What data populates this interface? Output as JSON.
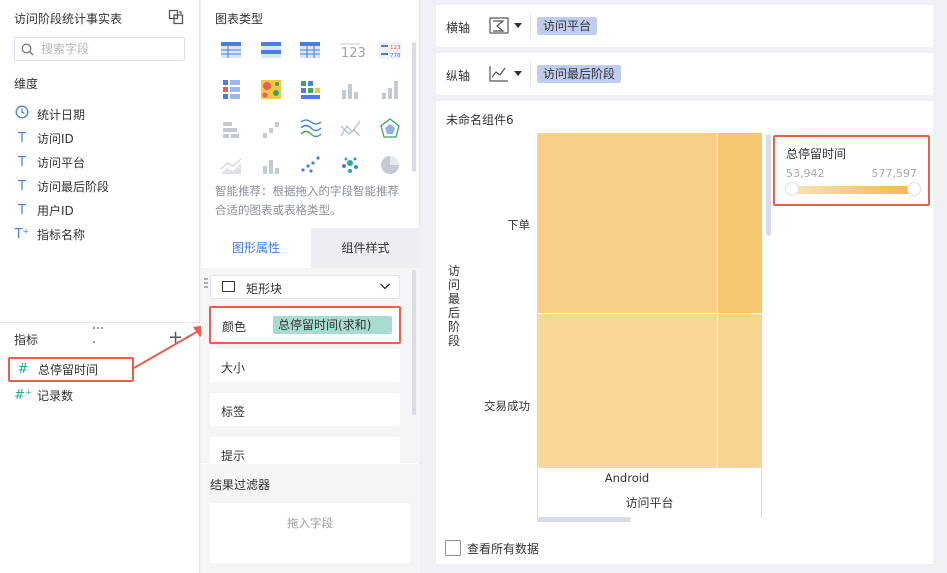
{
  "left_panel": {
    "title": "访问阶段统计事实表",
    "switch_icon": "switch-icon",
    "search_placeholder": "搜索字段",
    "dimensions_label": "维度",
    "dimensions": [
      {
        "icon": "clock-icon",
        "glyph": "◷",
        "label": "统计日期"
      },
      {
        "icon": "text-type-icon",
        "glyph": "T",
        "label": "访问ID"
      },
      {
        "icon": "text-type-icon",
        "glyph": "T",
        "label": "访问平台"
      },
      {
        "icon": "text-type-icon",
        "glyph": "T",
        "label": "访问最后阶段"
      },
      {
        "icon": "text-type-icon",
        "glyph": "T",
        "label": "用户ID"
      },
      {
        "icon": "text-calc-icon",
        "glyph": "T⁺",
        "label": "指标名称"
      }
    ],
    "measures_label": "指标",
    "measures": [
      {
        "icon": "hash-icon",
        "glyph": "#",
        "label": "总停留时间"
      },
      {
        "icon": "hash-calc-icon",
        "glyph": "#⁺",
        "label": "记录数"
      }
    ]
  },
  "middle_panel": {
    "chart_type_label": "图表类型",
    "smart_recommend": "智能推荐：根据拖入的字段智能推荐合适的图表或表格类型。",
    "tabs": [
      "图形属性",
      "组件样式"
    ],
    "shape": "矩形块",
    "props": {
      "color_label": "颜色",
      "color_field": "总停留时间(求和)",
      "size_label": "大小",
      "label_label": "标签",
      "tooltip_label": "提示"
    },
    "filter_title": "结果过滤器",
    "filter_drop": "拖入字段"
  },
  "right_panel": {
    "x_axis_label": "横轴",
    "x_axis_field": "访问平台",
    "y_axis_label": "纵轴",
    "y_axis_field": "访问最后阶段",
    "component_name": "未命名组件6",
    "view_all_label": "查看所有数据",
    "legend": {
      "title": "总停留时间",
      "min": "53,942",
      "max": "577,597",
      "color_low": "#fbe2b3",
      "color_high": "#f1b855"
    }
  },
  "chart_data": {
    "type": "heatmap",
    "x_title": "访问平台",
    "y_title": "访问最后阶段",
    "x_categories": [
      "Android"
    ],
    "y_categories": [
      "下单",
      "交易成功"
    ],
    "legend_range": [
      53942,
      577597
    ],
    "cell_colors": {
      "下单_main": "#f7cf86",
      "下单_right": "#f5c86f",
      "交易成功_main": "#f8d797",
      "交易成功_right": "#f7d48f"
    }
  }
}
